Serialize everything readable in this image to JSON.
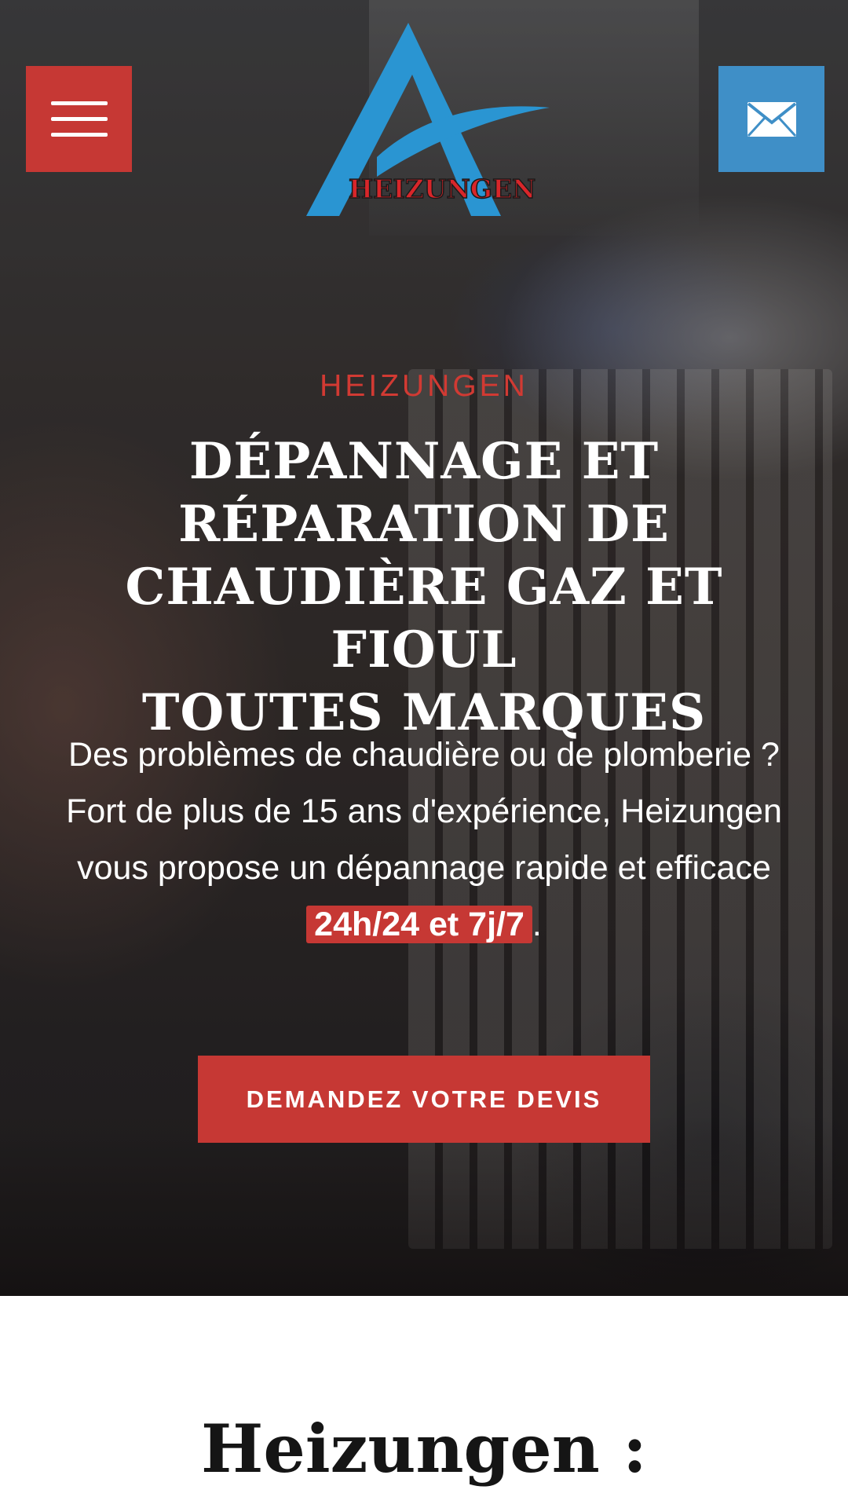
{
  "header": {
    "logo_text": "HEIZUNGEN",
    "menu_icon": "hamburger-menu-icon",
    "mail_icon": "envelope-icon"
  },
  "hero": {
    "eyebrow": "HEIZUNGEN",
    "title_lines": [
      "DÉPANNAGE ET",
      "RÉPARATION DE",
      "CHAUDIÈRE GAZ ET FIOUL",
      "TOUTES MARQUES"
    ],
    "text_main": "Des problèmes de chaudière ou de plomberie ? Fort de plus de 15 ans d'expérience, Heizungen vous propose un dépannage rapide et efficace ",
    "text_highlight": "24h/24 et 7j/7",
    "text_end": ".",
    "cta_label": "DEMANDEZ VOTRE DEVIS"
  },
  "section": {
    "title": "Heizungen :"
  },
  "colors": {
    "accent_red": "#c63834",
    "accent_blue": "#3f8fc7",
    "logo_blue": "#2a95d2"
  }
}
